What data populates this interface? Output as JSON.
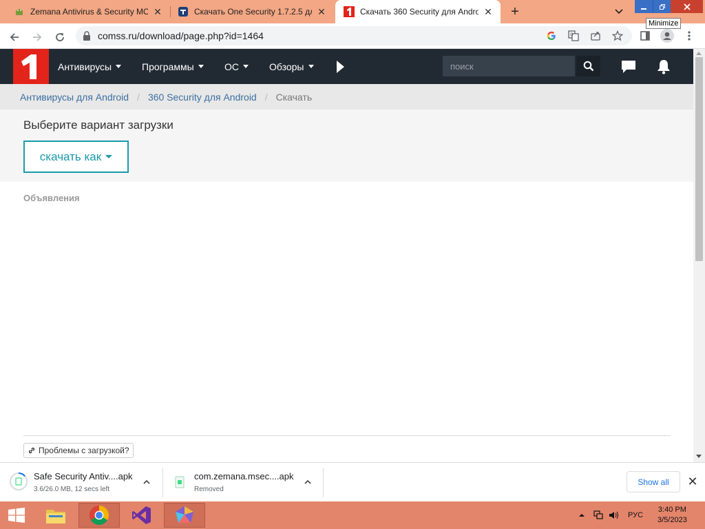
{
  "browser": {
    "tabs": [
      {
        "title": "Zemana Antivirus & Security MO",
        "favicon": "android-icon",
        "active": false
      },
      {
        "title": "Скачать One Security 1.7.2.5 для",
        "favicon": "t-logo-icon",
        "active": false
      },
      {
        "title": "Скачать 360 Security для Androi",
        "favicon": "comss-logo-icon",
        "active": true
      }
    ],
    "tooltip": "Minimize",
    "url": "comss.ru/download/page.php?id=1464"
  },
  "site": {
    "menu": [
      {
        "label": "Антивирусы"
      },
      {
        "label": "Программы"
      },
      {
        "label": "ОС"
      },
      {
        "label": "Обзоры"
      }
    ],
    "search_placeholder": "поиск",
    "breadcrumb": [
      {
        "label": "Антивирусы для Android",
        "link": true
      },
      {
        "label": "360 Security для Android",
        "link": true
      },
      {
        "label": "Скачать",
        "link": false
      }
    ],
    "heading": "Выберите вариант загрузки",
    "download_button": "скачать как",
    "ads_label": "Объявления",
    "problems_button": "Проблемы с загрузкой?"
  },
  "downloads": {
    "items": [
      {
        "name": "Safe Security Antiv....apk",
        "status": "3.6/26.0 MB, 12 secs left",
        "progress": 0.14
      },
      {
        "name": "com.zemana.msec....apk",
        "status": "Removed"
      }
    ],
    "show_all": "Show all"
  },
  "taskbar": {
    "language": "РУС",
    "time": "3:40 PM",
    "date": "3/5/2023"
  },
  "colors": {
    "tabstrip": "#f3a784",
    "site_header": "#212a33",
    "logo_red": "#e3241b",
    "accent_teal": "#1a9aab",
    "taskbar": "#e3856b"
  }
}
